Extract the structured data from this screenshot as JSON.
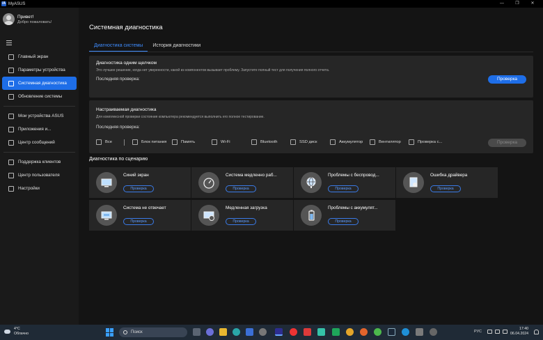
{
  "window": {
    "title": "MyASUS",
    "controls": [
      "—",
      "❐",
      "✕"
    ]
  },
  "sidebar": {
    "user": {
      "greeting": "Привет!",
      "subtitle": "Добро пожаловать!"
    },
    "items": [
      {
        "label": "Главный экран"
      },
      {
        "label": "Параметры устройства"
      },
      {
        "label": "Системная диагностика",
        "active": true
      },
      {
        "label": "Обновление системы"
      },
      {
        "label": "Мои устройства ASUS"
      },
      {
        "label": "Приложения и..."
      },
      {
        "label": "Центр сообщений"
      },
      {
        "label": "Поддержка клиентов"
      },
      {
        "label": "Центр пользователя"
      },
      {
        "label": "Настройки"
      }
    ]
  },
  "main": {
    "title": "Системная диагностика",
    "tabs": [
      {
        "label": "Диагностика системы",
        "active": true
      },
      {
        "label": "История диагностики"
      }
    ],
    "one_click": {
      "title": "Диагностика одним щелчком",
      "description": "Это лучшее решение, когда нет уверенности, какой из компонентов вызывает проблему. Запустите полный тест для получения полного отчета.",
      "last_check_label": "Последняя проверка:",
      "button": "Проверка"
    },
    "custom": {
      "title": "Настраиваемая диагностика",
      "description": "Для комплексной проверки состояния компьютера рекомендуется выполнить его полное тестирование.",
      "last_check_label": "Последняя проверка:",
      "checkboxes": [
        "Все",
        "Блок питания",
        "Память",
        "Wi-Fi",
        "Bluetooth",
        "SSD диск",
        "Аккумулятор",
        "Вентилятор",
        "Проверка с..."
      ],
      "button": "Проверка"
    },
    "scenario_title": "Диагностика по сценарию",
    "scenarios": [
      {
        "title": "Синий экран",
        "button": "Проверка",
        "icon": "monitor-icon"
      },
      {
        "title": "Система медленно раб...",
        "button": "Проверка",
        "icon": "speedometer-icon"
      },
      {
        "title": "Проблемы с беспровод...",
        "button": "Проверка",
        "icon": "globe-icon"
      },
      {
        "title": "Ошибка драйвера",
        "button": "Проверка",
        "icon": "driver-icon"
      },
      {
        "title": "Система не отвечает",
        "button": "Проверка",
        "icon": "frozen-screen-icon"
      },
      {
        "title": "Медленная загрузка",
        "button": "Проверка",
        "icon": "slow-boot-icon"
      },
      {
        "title": "Проблемы с аккумулят...",
        "button": "Проверка",
        "icon": "battery-icon"
      }
    ]
  },
  "taskbar": {
    "weather": {
      "temp": "4°C",
      "condition": "Облачно"
    },
    "search_placeholder": "Поиск",
    "language": "РУС",
    "time": "17:40",
    "date": "06.04.2024"
  }
}
